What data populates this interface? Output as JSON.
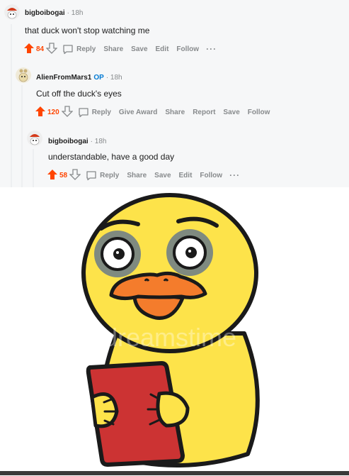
{
  "comments": [
    {
      "username": "bigboibogai",
      "op": "",
      "time": "· 18h",
      "body": "that duck won't stop watching me",
      "votes": "84",
      "actions": [
        "Reply",
        "Share",
        "Save",
        "Edit",
        "Follow"
      ],
      "more": "···"
    },
    {
      "username": "AlienFromMars1",
      "op": "OP",
      "time": "· 18h",
      "body": "Cut off the duck's eyes",
      "votes": "120",
      "actions": [
        "Reply",
        "Give Award",
        "Share",
        "Report",
        "Save",
        "Follow"
      ],
      "more": ""
    },
    {
      "username": "bigboibogai",
      "op": "",
      "time": "· 18h",
      "body": "understandable, have a good day",
      "votes": "58",
      "actions": [
        "Reply",
        "Share",
        "Save",
        "Edit",
        "Follow"
      ],
      "more": "···"
    }
  ],
  "image": {
    "watermark": "dreamstime",
    "colors": {
      "duck": "#fde34a",
      "duck_outline": "#1a1a1a",
      "beak": "#f47c2c",
      "eye_ring": "#7f8a80",
      "tablet": "#cc3333"
    }
  },
  "colors": {
    "upvote": "#ff4500",
    "meta_gray": "#878a8c",
    "op_blue": "#0079d3",
    "panel_bg": "#f6f7f8"
  },
  "icons": [
    "upvote-arrow-icon",
    "downvote-arrow-icon",
    "comment-bubble-icon",
    "more-dots-icon"
  ]
}
